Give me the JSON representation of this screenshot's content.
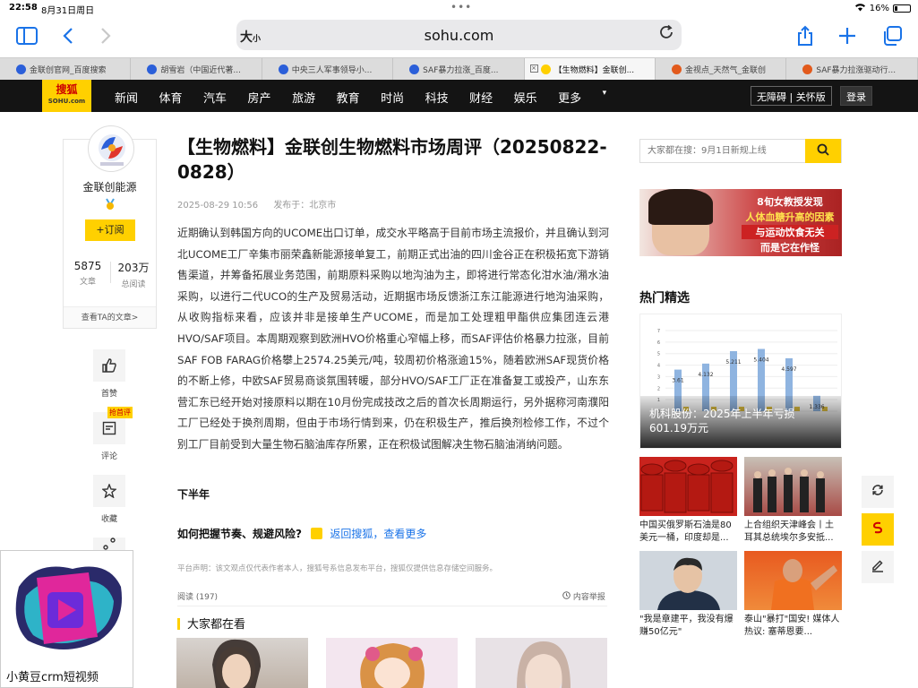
{
  "status": {
    "time": "22:58",
    "date": "8月31日周日",
    "battery": "16%",
    "battery_level": 0.16
  },
  "browser": {
    "text_size": "大",
    "text_size_small": "小",
    "url": "sohu.com",
    "tabs": [
      {
        "label": "金联创官网_百度搜索",
        "color": "#2b5fd9"
      },
      {
        "label": "胡雪岩（中国近代著...",
        "color": "#2b5fd9"
      },
      {
        "label": "中央三人军事领导小...",
        "color": "#2b5fd9"
      },
      {
        "label": "SAF暴力拉涨_百度...",
        "color": "#2b5fd9"
      },
      {
        "label": "【生物燃料】金联创...",
        "color": "#ffd000",
        "active": true
      },
      {
        "label": "金视点_天然气_金联创",
        "color": "#e25a1c"
      },
      {
        "label": "SAF暴力拉涨驱动行...",
        "color": "#e25a1c"
      }
    ]
  },
  "nav": {
    "logo": "搜狐",
    "logo_sub": "SOHU.com",
    "items": [
      "新闻",
      "体育",
      "汽车",
      "房产",
      "旅游",
      "教育",
      "时尚",
      "科技",
      "财经",
      "娱乐",
      "更多"
    ],
    "accessibility": "无障碍 | 关怀版",
    "login": "登录"
  },
  "author": {
    "name": "金联创能源",
    "subscribe": "+订阅",
    "articles_num": "5875",
    "articles_label": "文章",
    "reads_num": "203万",
    "reads_label": "总阅读",
    "see_articles": "查看TA的文章>"
  },
  "actions": {
    "like": "首赞",
    "comment": "评论",
    "comment_badge": "抢首评",
    "favorite": "收藏"
  },
  "article": {
    "title": "【生物燃料】金联创生物燃料市场周评（20250822-0828）",
    "datetime": "2025-08-29 10:56",
    "published_from": "发布于：北京市",
    "body": "近期确认到韩国方向的UCOME出口订单，成交水平略高于目前市场主流报价，并且确认到河北UCOME工厂辛集市丽荣鑫新能源接单复工，前期正式出油的四川金谷正在积极拓宽下游销售渠道，并筹备拓展业务范围，前期原料采购以地沟油为主，即将进行常态化泔水油/潲水油采购，以进行二代UCO的生产及贸易活动，近期据市场反馈浙江东江能源进行地沟油采购，从收购指标来看，应该并非是接单生产UCOME，而是加工处理粗甲酯供应集团连云港HVO/SAF项目。本周期观察到欧洲HVO价格重心窄幅上移，而SAF评估价格暴力拉涨，目前SAF FOB FARAG价格攀上2574.25美元/吨，较周初价格涨逾15%，随着欧洲SAF现货价格的不断上修，中欧SAF贸易商谈氛围转暖，部分HVO/SAF工厂正在准备复工或投产，山东东营汇东已经开始对接原料以期在10月份完成技改之后的首次长周期运行，另外据称河南濮阳工厂已经处于换剂周期，但由于市场行情到来，仍在积极生产，推后换剂检修工作，不过个别工厂目前受到大量生物石脑油库存所累，正在积极试图解决生物石脑油消纳问题。",
    "subhead": "下半年",
    "more_q": "如何把握节奏、规避风险?",
    "more_link": "返回搜狐，查看更多",
    "disclaimer": "平台声明：该文观点仅代表作者本人，搜狐号系信息发布平台，搜狐仅提供信息存储空间服务。",
    "reads": "阅读 (197)",
    "report": "内容举报",
    "everyone_watching": "大家都在看"
  },
  "sidebar": {
    "search_placeholder": "大家都在搜：9月1日新规上线",
    "ad_lines": [
      "8旬女教授发现",
      "人体血糖升高的因素",
      "与运动饮食无关",
      "而是它在作怪"
    ],
    "hot_title": "热门精选",
    "hot_main_caption": "机科股份：2025年上半年亏损601.19万元",
    "hot_chart_labels": [
      "3.61",
      "4.132",
      "5.211",
      "5.404",
      "4.597",
      "1.336"
    ],
    "hot_chart_axis": [
      "7",
      "6",
      "5",
      "4",
      "3",
      "2",
      "1",
      "0"
    ],
    "grid": [
      {
        "text": "中国买俄罗斯石油是80美元一桶，印度却是..."
      },
      {
        "text": "上合组织天津峰会丨土耳其总统埃尔多安抵..."
      },
      {
        "text": "\"我是章建平，我没有爆赚50亿元\""
      },
      {
        "text": "泰山\"暴打\"国安! 媒体人热议: 塞蒂恩要..."
      }
    ]
  },
  "pip": {
    "caption": "小黄豆crm短视频"
  }
}
